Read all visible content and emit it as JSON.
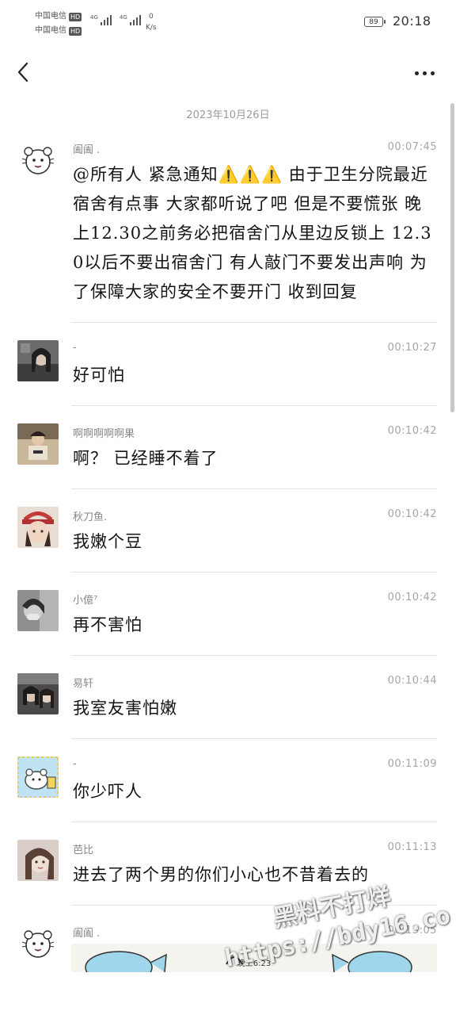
{
  "status_bar": {
    "carrier_1": "中国电信",
    "carrier_2": "中国电信",
    "hd_badge": "HD",
    "signal_label": "4G",
    "net_speed_value": "0",
    "net_speed_unit": "K/s",
    "battery": "89",
    "time": "20:18"
  },
  "chat": {
    "date": "2023年10月26日",
    "messages": [
      {
        "sender": "阖阖 .",
        "time": "00:07:45",
        "text": "@所有人 紧急通知⚠️⚠️⚠️ 由于卫生分院最近宿舍有点事 大家都听说了吧 但是不要慌张 晚上12.30之前务必把宿舍门从里边反锁上 12.30以后不要出宿舍门 有人敲门不要发出声响 为了保障大家的安全不要开门 收到回复"
      },
      {
        "sender": "-",
        "time": "00:10:27",
        "text": "好可怕"
      },
      {
        "sender": "啊啊啊啊啊果",
        "time": "00:10:42",
        "text": "啊？ 已经睡不着了"
      },
      {
        "sender": "秋刀鱼.",
        "time": "00:10:42",
        "text": "我嫩个豆"
      },
      {
        "sender": "小億⁷",
        "time": "00:10:42",
        "text": "再不害怕"
      },
      {
        "sender": "易轩",
        "time": "00:10:44",
        "text": "我室友害怕嫩"
      },
      {
        "sender": "-",
        "time": "00:11:09",
        "text": "你少吓人"
      },
      {
        "sender": "芭比",
        "time": "00:11:13",
        "text": "进去了两个男的你们小心也不昔着去的"
      },
      {
        "sender": "阖阖 .",
        "time": "00:13:05",
        "sticker_caption": "晚上6:23"
      }
    ]
  },
  "watermark": {
    "line1": "黑料不打烊",
    "line2": "https://bdy16.co"
  },
  "colors": {
    "text": "#141414",
    "meta": "#a5a5a5",
    "divider": "#e3e3e3"
  }
}
